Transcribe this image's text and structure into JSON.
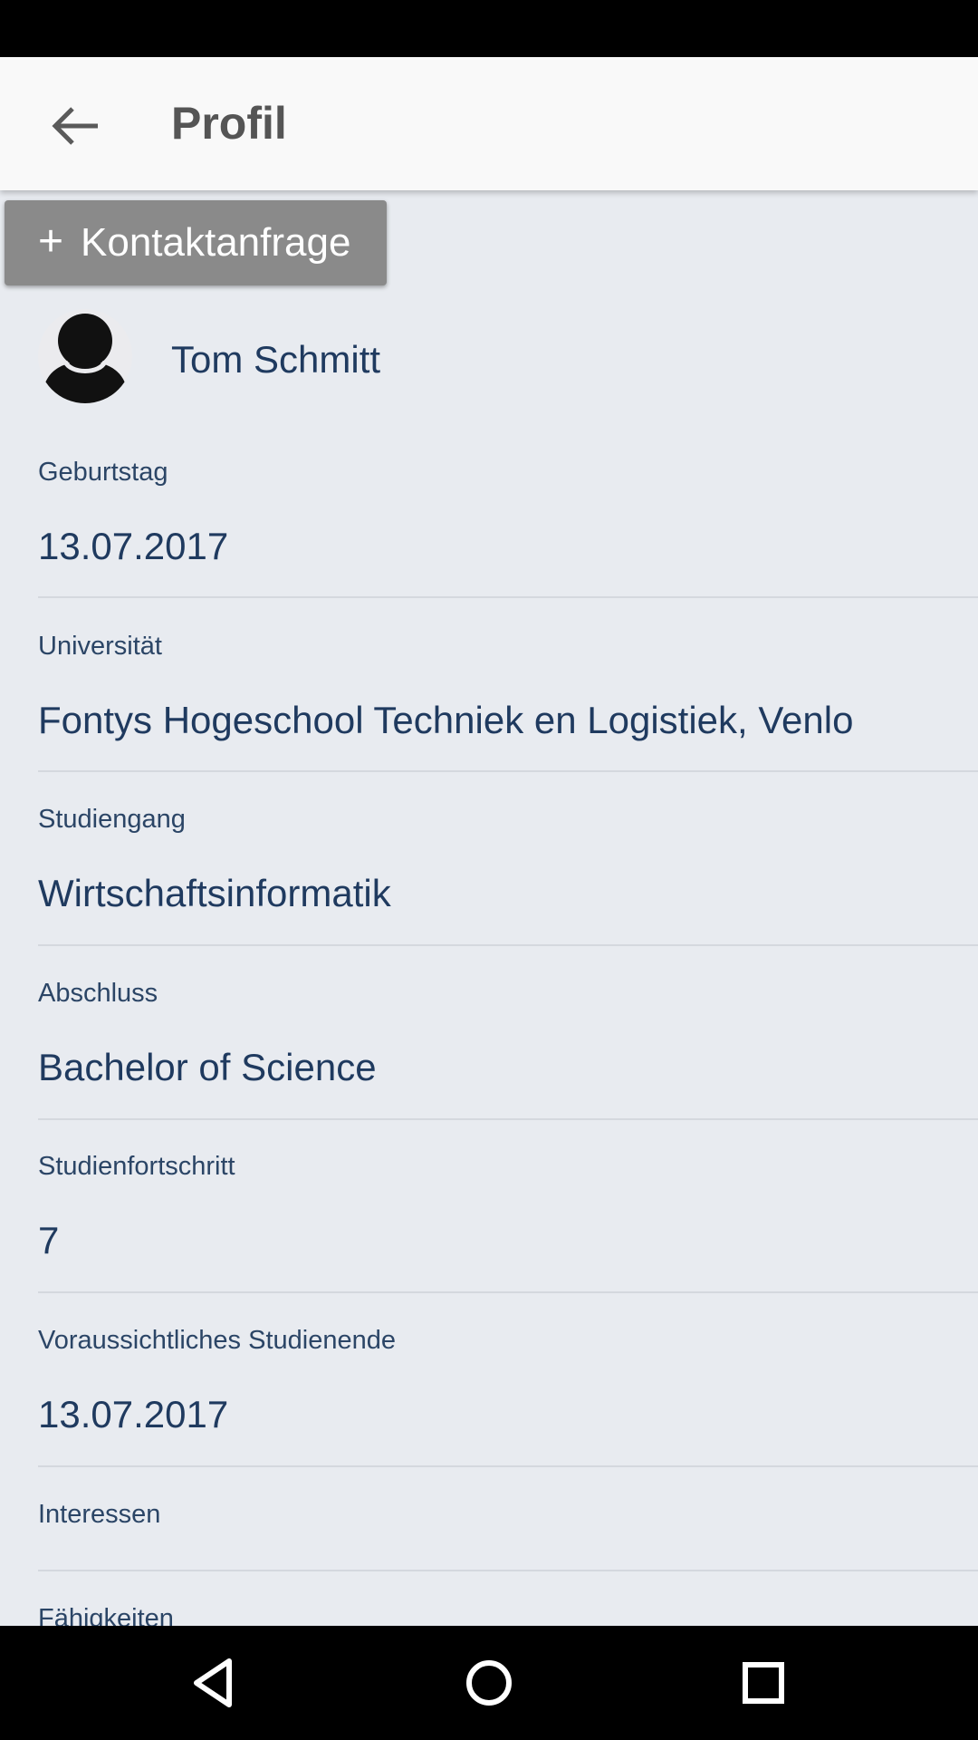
{
  "header": {
    "title": "Profil",
    "back_icon": "arrow-back-icon"
  },
  "actions": {
    "contact_request_label": "Kontaktanfrage",
    "contact_request_icon": "plus-icon"
  },
  "profile": {
    "name": "Tom Schmitt",
    "avatar_icon": "person-avatar-icon",
    "fields": [
      {
        "label": "Geburtstag",
        "value": "13.07.2017"
      },
      {
        "label": "Universität",
        "value": "Fontys Hogeschool Techniek en Logistiek, Venlo"
      },
      {
        "label": "Studiengang",
        "value": "Wirtschaftsinformatik"
      },
      {
        "label": "Abschluss",
        "value": "Bachelor of Science"
      },
      {
        "label": "Studienfortschritt",
        "value": "7"
      },
      {
        "label": "Voraussichtliches Studienende",
        "value": "13.07.2017"
      },
      {
        "label": "Interessen",
        "value": ""
      },
      {
        "label": "Fähigkeiten",
        "value": ""
      }
    ]
  },
  "navigation": {
    "back_icon": "nav-back-triangle-icon",
    "home_icon": "nav-home-circle-icon",
    "recents_icon": "nav-recents-square-icon"
  },
  "colors": {
    "app_bar": "#f9f9f9",
    "background": "#e8ebf0",
    "button": "#8a8a8a",
    "text": "#1f3a5f"
  }
}
